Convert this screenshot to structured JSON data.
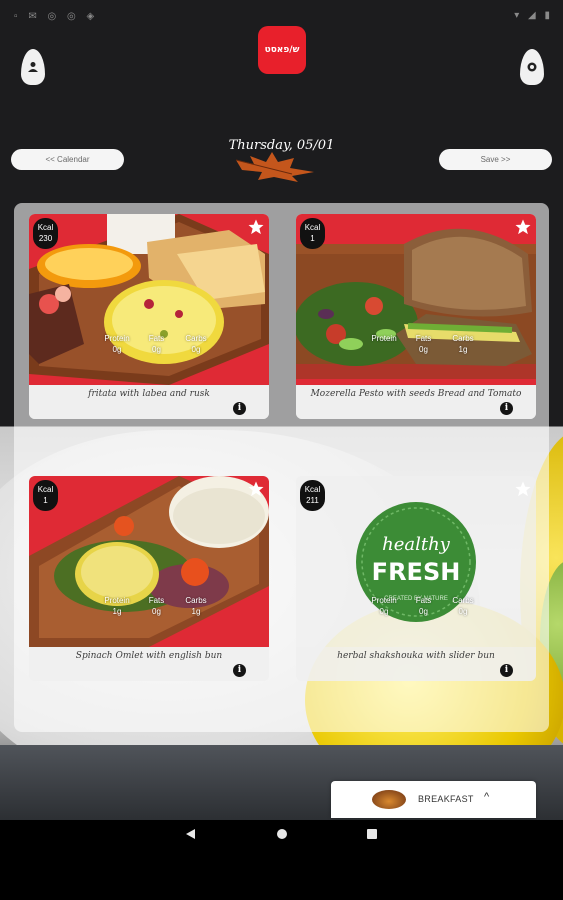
{
  "status_bar": {
    "left_icons": "▫ ✉ ◎ ◎ ◈",
    "right_icons": "▾ ◢ ▮"
  },
  "header": {
    "logo_text": "ש/פאסט",
    "date": "Thursday, 05/01",
    "prev_label": "<< Calendar",
    "next_label": "Save >>"
  },
  "meals": [
    {
      "name": "fritata with labea and rusk",
      "kcal_label": "Kcal",
      "kcal": "230",
      "macros": [
        {
          "label": "Protein",
          "value": "0g"
        },
        {
          "label": "Fats",
          "value": "0g"
        },
        {
          "label": "Carbs",
          "value": "0g"
        }
      ]
    },
    {
      "name": "Mozerella Pesto with seeds Bread and Tomato",
      "kcal_label": "Kcal",
      "kcal": "1",
      "macros": [
        {
          "label": "Protein",
          "value": ""
        },
        {
          "label": "Fats",
          "value": "0g"
        },
        {
          "label": "Carbs",
          "value": "1g"
        }
      ]
    },
    {
      "name": "Spinach Omlet with english bun",
      "kcal_label": "Kcal",
      "kcal": "1",
      "macros": [
        {
          "label": "Protein",
          "value": "1g"
        },
        {
          "label": "Fats",
          "value": "0g"
        },
        {
          "label": "Carbs",
          "value": "1g"
        }
      ]
    },
    {
      "name": "herbal shakshouka with slider bun",
      "kcal_label": "Kcal",
      "kcal": "211",
      "badge_text_1": "healthy",
      "badge_text_2": "FRESH",
      "badge_text_3": "CREATED BY NATURE",
      "macros": [
        {
          "label": "Protein",
          "value": "0g"
        },
        {
          "label": "Fats",
          "value": "0g"
        },
        {
          "label": "Carbs",
          "value": "0g"
        }
      ]
    }
  ],
  "meal_selector": {
    "label": "BREAKFAST",
    "chevron": "^"
  },
  "colors": {
    "brand": "#e8202b",
    "card_red": "#df2a35",
    "star": "#ffffff"
  }
}
